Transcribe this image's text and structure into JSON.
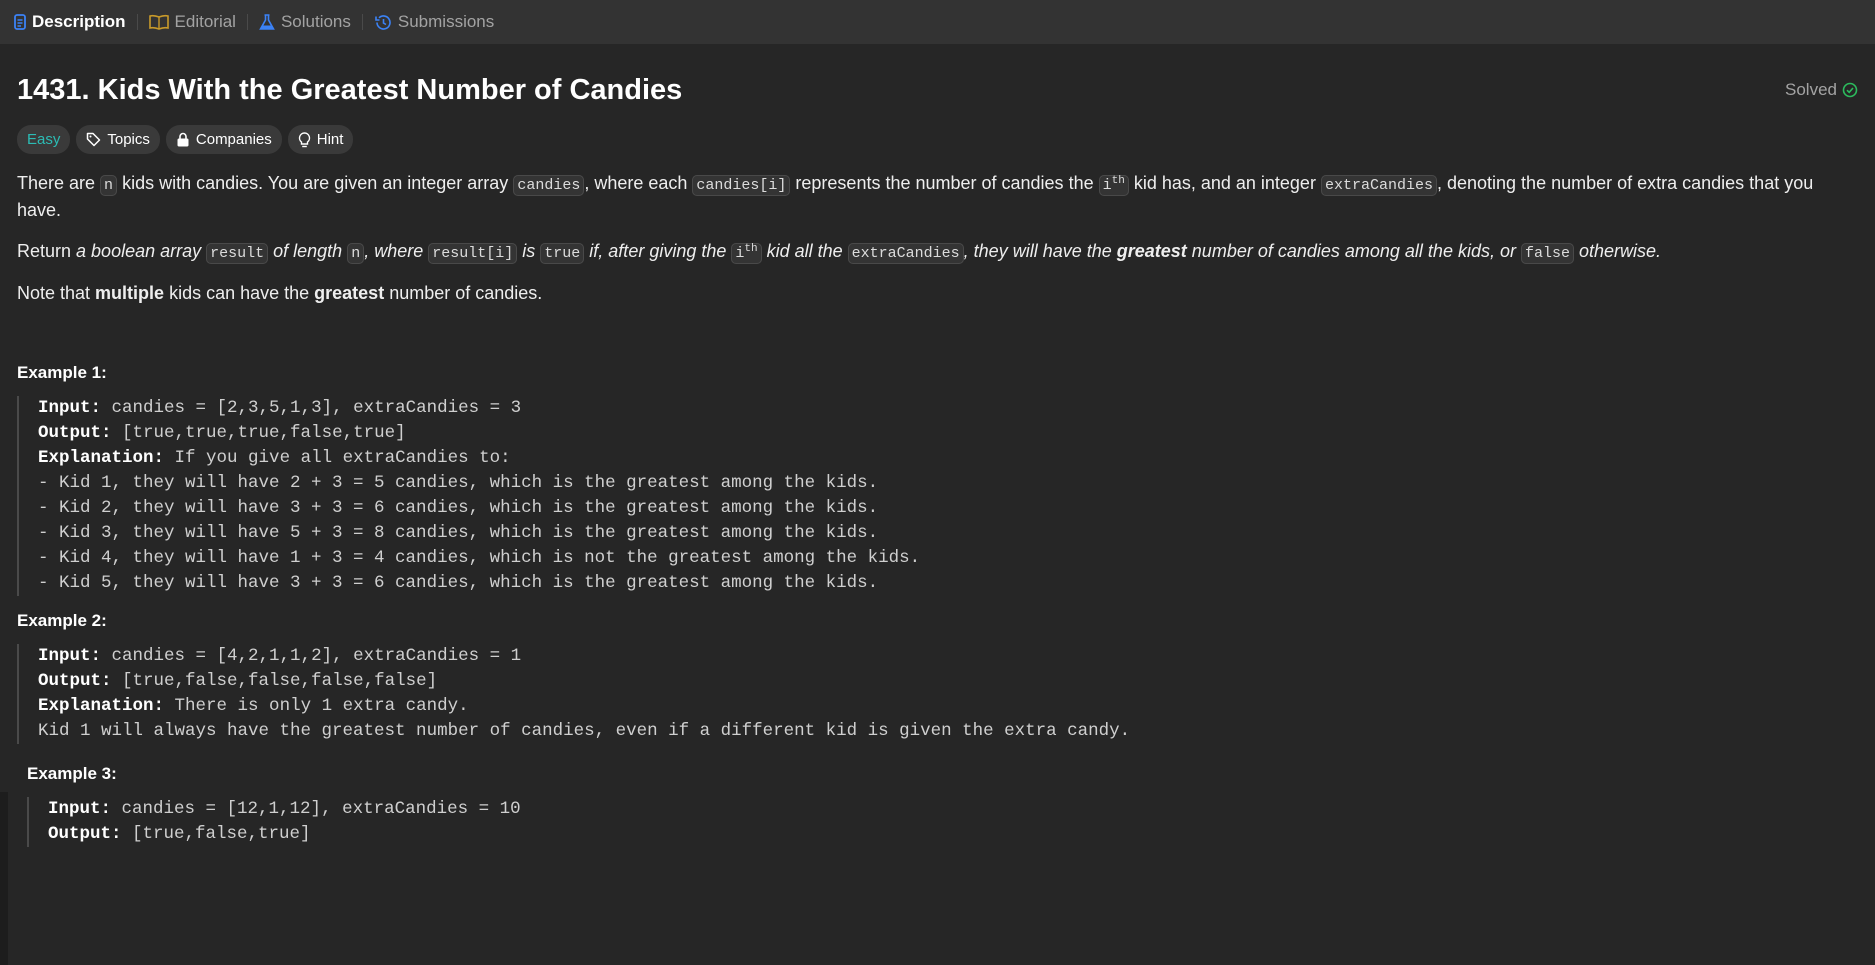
{
  "tabs": [
    {
      "label": "Description",
      "icon": "description-icon"
    },
    {
      "label": "Editorial",
      "icon": "book-icon"
    },
    {
      "label": "Solutions",
      "icon": "flask-icon"
    },
    {
      "label": "Submissions",
      "icon": "history-icon"
    }
  ],
  "problem": {
    "title": "1431. Kids With the Greatest Number of Candies",
    "status": "Solved",
    "tags": [
      "Easy",
      "Topics",
      "Companies",
      "Hint"
    ]
  },
  "description": {
    "p1": {
      "a": "There are ",
      "code1": "n",
      "b": " kids with candies. You are given an integer array ",
      "code2": "candies",
      "c": ", where each ",
      "code3": "candies[i]",
      "d": " represents the number of candies the ",
      "code4": "i",
      "sup": "th",
      "e": " kid has, and an integer ",
      "code5": "extraCandies",
      "f": ", denoting the number of extra candies that you have."
    },
    "p2": {
      "a": "Return ",
      "b": "a boolean array ",
      "code1": "result",
      "c": " of length ",
      "code2": "n",
      "d": ", where ",
      "code3": "result[i]",
      "e": " is ",
      "code4": "true",
      "f": " if, after giving the ",
      "code5": "i",
      "sup": "th",
      "g": " kid all the ",
      "code6": "extraCandies",
      "h": ", they will have the ",
      "i": "greatest",
      "j": " number of candies among all the kids, or ",
      "code7": "false",
      "k": " otherwise."
    },
    "p3": {
      "a": "Note that ",
      "b": "multiple",
      "c": " kids can have the ",
      "d": "greatest",
      "e": " number of candies."
    }
  },
  "examples": [
    {
      "title": "Example 1:",
      "input": "candies = [2,3,5,1,3], extraCandies = 3",
      "output": "[true,true,true,false,true]",
      "explanation": "If you give all extraCandies to:",
      "lines": [
        "- Kid 1, they will have 2 + 3 = 5 candies, which is the greatest among the kids.",
        "- Kid 2, they will have 3 + 3 = 6 candies, which is the greatest among the kids.",
        "- Kid 3, they will have 5 + 3 = 8 candies, which is the greatest among the kids.",
        "- Kid 4, they will have 1 + 3 = 4 candies, which is not the greatest among the kids.",
        "- Kid 5, they will have 3 + 3 = 6 candies, which is the greatest among the kids."
      ]
    },
    {
      "title": "Example 2:",
      "input": "candies = [4,2,1,1,2], extraCandies = 1",
      "output": "[true,false,false,false,false]",
      "explanation": "There is only 1 extra candy.",
      "lines": [
        "Kid 1 will always have the greatest number of candies, even if a different kid is given the extra candy."
      ]
    },
    {
      "title": "Example 3:",
      "input": "candies = [12,1,12], extraCandies = 10",
      "output": "[true,false,true]"
    }
  ],
  "labels": {
    "input": "Input:",
    "output": "Output:",
    "explanation": "Explanation:"
  },
  "colors": {
    "background": "#262626",
    "tabbar": "#333333",
    "easy": "#2cbbb4",
    "solved_check": "#2cbb5d",
    "description_icon": "#3b82f6",
    "editorial_icon": "#b8860b",
    "solutions_icon": "#3b82f6",
    "submissions_icon": "#3b82f6"
  }
}
